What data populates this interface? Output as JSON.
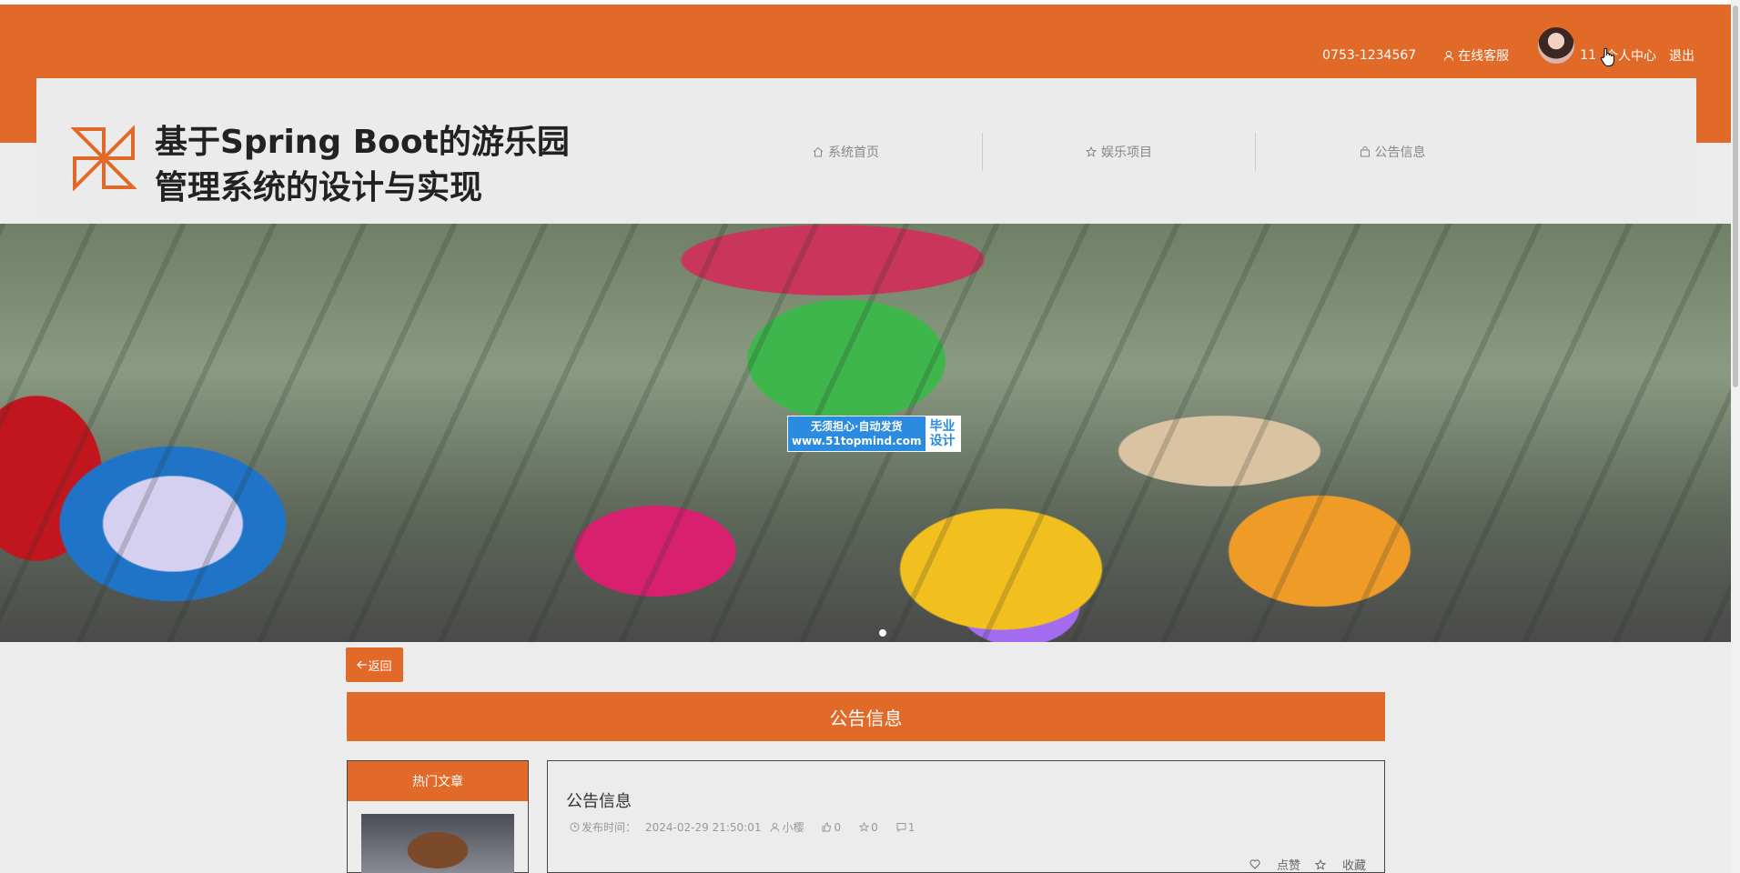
{
  "topbar": {
    "phone": "0753-1234567",
    "service_label": "在线客服",
    "username": "11",
    "center_label": "个人中心",
    "logout_label": "退出"
  },
  "header": {
    "site_title": "基于Spring Boot的游乐园管理系统的设计与实现",
    "nav": [
      {
        "label": "系统首页",
        "icon": "home-icon"
      },
      {
        "label": "娱乐项目",
        "icon": "star-icon"
      },
      {
        "label": "公告信息",
        "icon": "bag-icon"
      }
    ]
  },
  "banner": {
    "watermark_left_line1": "无须担心·自动发货",
    "watermark_left_line2": "www.51topmind.com",
    "watermark_right_line1": "毕业",
    "watermark_right_line2": "设计"
  },
  "main": {
    "back_label": "返回",
    "section_title": "公告信息",
    "hot_title": "热门文章",
    "article": {
      "title": "公告信息",
      "publish_label": "发布时间：",
      "publish_time": "2024-02-29 21:50:01",
      "author": "小樱",
      "likes": "0",
      "favorites": "0",
      "comments": "1",
      "like_action": "点赞",
      "fav_action": "收藏"
    }
  },
  "colors": {
    "accent": "#e26a28"
  }
}
